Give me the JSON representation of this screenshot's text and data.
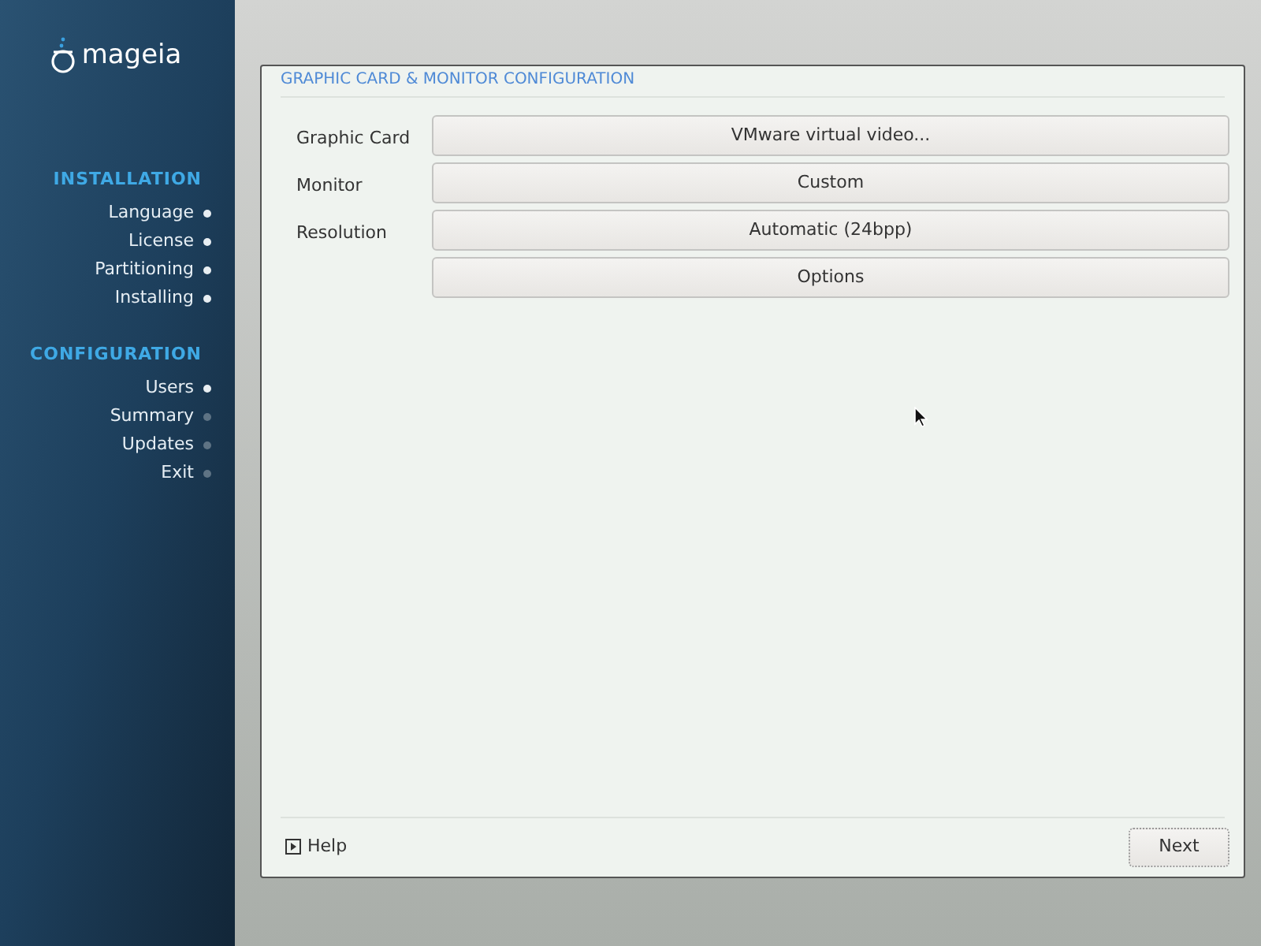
{
  "sidebar": {
    "logo": "mageia",
    "sections": [
      {
        "title": "INSTALLATION",
        "steps": [
          {
            "label": "Language",
            "done": true
          },
          {
            "label": "License",
            "done": true
          },
          {
            "label": "Partitioning",
            "done": true
          },
          {
            "label": "Installing",
            "done": true
          }
        ]
      },
      {
        "title": "CONFIGURATION",
        "steps": [
          {
            "label": "Users",
            "done": true
          },
          {
            "label": "Summary",
            "done": false
          },
          {
            "label": "Updates",
            "done": false
          },
          {
            "label": "Exit",
            "done": false
          }
        ]
      }
    ]
  },
  "dialog": {
    "title": "GRAPHIC CARD & MONITOR CONFIGURATION",
    "rows": [
      {
        "label": "Graphic Card",
        "button": "VMware virtual video..."
      },
      {
        "label": "Monitor",
        "button": "Custom"
      },
      {
        "label": "Resolution",
        "button": "Automatic (24bpp)"
      },
      {
        "button": "Options"
      }
    ],
    "help": "Help",
    "next": "Next"
  }
}
